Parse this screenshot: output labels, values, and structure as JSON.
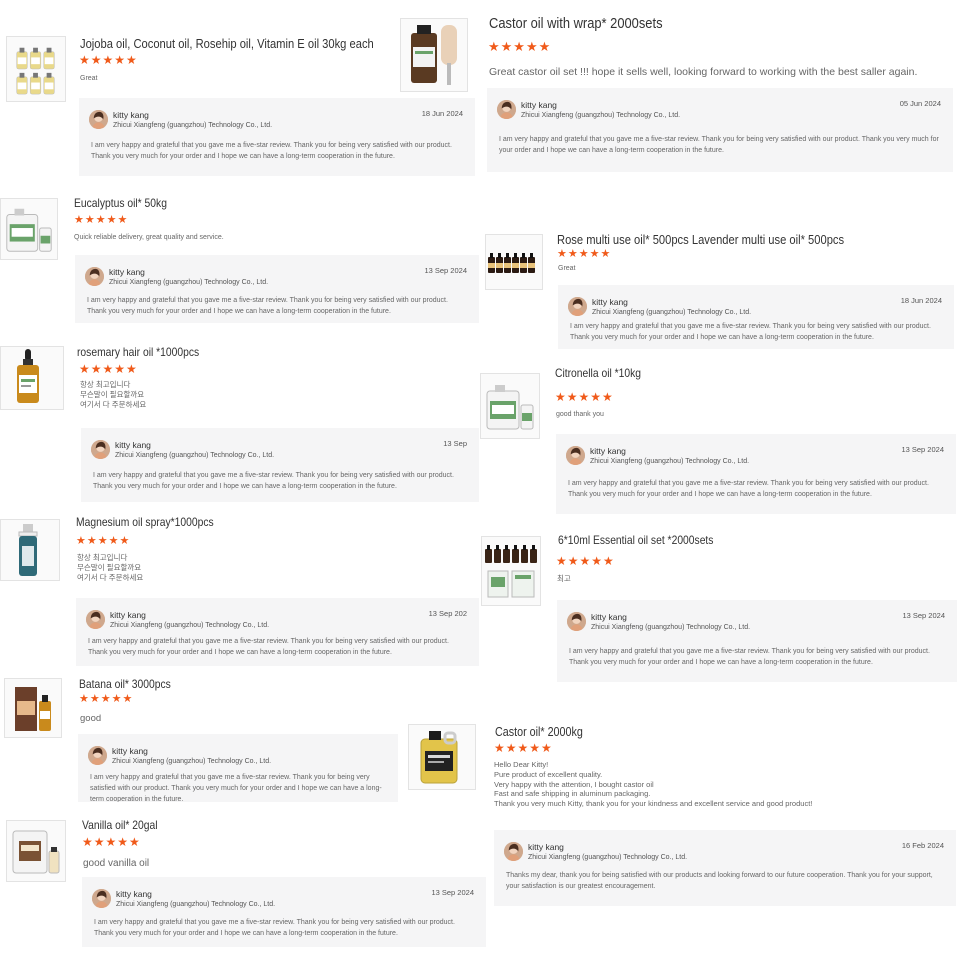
{
  "colors": {
    "star": "#f05a1a",
    "reply_bg": "#f5f5f6"
  },
  "reviews": [
    {
      "product": "Jojoba oil, Coconut oil, Rosehip oil, Vitamin E oil 30kg each",
      "stars": "★★★★★",
      "comment": "Great",
      "thumb_icon": "oil-bottles-set-icon",
      "reply": {
        "seller": "kitty kang",
        "company": "Zhicui Xiangfeng (guangzhou) Technology Co., Ltd.",
        "date": "18 Jun 2024",
        "text": "I am very happy and grateful that you gave me a five-star review. Thank you for being very satisfied with our product. Thank you very much for your order and I hope we can have a long-term cooperation in the future."
      }
    },
    {
      "product": "Castor oil with wrap* 2000sets",
      "stars": "★★★★★",
      "comment": "Great castor oil set !!! hope it sells well, looking forward to working with the best saller again.",
      "thumb_icon": "castor-oil-bottle-icon",
      "reply": {
        "seller": "kitty kang",
        "company": "Zhicui Xiangfeng (guangzhou) Technology Co., Ltd.",
        "date": "05 Jun 2024",
        "text": "I am very happy and grateful that you gave me a five-star review. Thank you for being very satisfied with our product. Thank you very much for your order and I hope we can have a long-term cooperation in the future."
      }
    },
    {
      "product": "Eucalyptus oil* 50kg",
      "stars": "★★★★★",
      "comment": "Quick reliable delivery, great quality and service.",
      "thumb_icon": "oil-drum-icon",
      "reply": {
        "seller": "kitty kang",
        "company": "Zhicui Xiangfeng (guangzhou) Technology Co., Ltd.",
        "date": "13 Sep 2024",
        "text": "I am very happy and grateful that you gave me a five-star review. Thank you for being very satisfied with our product. Thank you very much for your order and I hope we can have a long-term cooperation in the future."
      }
    },
    {
      "product": "Rose multi use oil* 500pcs Lavender multi use oil* 500pcs",
      "stars": "★★★★★",
      "comment": "Great",
      "thumb_icon": "bottle-row-icon",
      "reply": {
        "seller": "kitty kang",
        "company": "Zhicui Xiangfeng (guangzhou) Technology Co., Ltd.",
        "date": "18 Jun 2024",
        "text": "I am very happy and grateful that you gave me a five-star review. Thank you for being very satisfied with our product. Thank you very much for your order and I hope we can have a long-term cooperation in the future."
      }
    },
    {
      "product": "rosemary hair oil *1000pcs",
      "stars": "★★★★★",
      "comment": "항상 최고입니다\n무슨말이 필요할까요\n여기서 다 주문하세요",
      "thumb_icon": "dropper-bottle-icon",
      "reply": {
        "seller": "kitty kang",
        "company": "Zhicui Xiangfeng (guangzhou) Technology Co., Ltd.",
        "date": "13 Sep",
        "text": "I am very happy and grateful that you gave me a five-star review. Thank you for being very satisfied with our product. Thank you very much for your order and I hope we can have a long-term cooperation in the future."
      }
    },
    {
      "product": "Citronella oil *10kg",
      "stars": "★★★★★",
      "comment": "good thank you",
      "thumb_icon": "oil-drum-icon",
      "reply": {
        "seller": "kitty kang",
        "company": "Zhicui Xiangfeng (guangzhou) Technology Co., Ltd.",
        "date": "13 Sep 2024",
        "text": "I am very happy and grateful that you gave me a five-star review. Thank you for being very satisfied with our product. Thank you very much for your order and I hope we can have a long-term cooperation in the future."
      }
    },
    {
      "product": "Magnesium oil spray*1000pcs",
      "stars": "★★★★★",
      "comment": "항상 최고입니다\n무슨말이 필요할까요\n여기서 다 주문하세요",
      "thumb_icon": "spray-bottle-icon",
      "reply": {
        "seller": "kitty kang",
        "company": "Zhicui Xiangfeng (guangzhou) Technology Co., Ltd.",
        "date": "13 Sep 202",
        "text": "I am very happy and grateful that you gave me a five-star review. Thank you for being very satisfied with our product. Thank you very much for your order and I hope we can have a long-term cooperation in the future."
      }
    },
    {
      "product": "6*10ml Essential oil set *2000sets",
      "stars": "★★★★★",
      "comment": "최고",
      "thumb_icon": "essential-oil-set-icon",
      "reply": {
        "seller": "kitty kang",
        "company": "Zhicui Xiangfeng (guangzhou) Technology Co., Ltd.",
        "date": "13 Sep 2024",
        "text": "I am very happy and grateful that you gave me a five-star review. Thank you for being very satisfied with our product. Thank you very much for your order and I hope we can have a long-term cooperation in the future."
      }
    },
    {
      "product": "Batana oil* 3000pcs",
      "stars": "★★★★★",
      "comment": "good",
      "thumb_icon": "batana-oil-box-icon",
      "reply": {
        "seller": "kitty kang",
        "company": "Zhicui Xiangfeng (guangzhou) Technology Co., Ltd.",
        "date": "",
        "text": "I am very happy and grateful that you gave me a five-star review. Thank you for being very satisfied with our product. Thank you very much for your order and I hope we can have a long-term cooperation in the future."
      }
    },
    {
      "product": "Castor oil* 2000kg",
      "stars": "★★★★★",
      "comment": "Hello Dear Kitty!\nPure product of excellent quality.\nVery happy with the attention, I bought castor oil\nFast and safe shipping in aluminum packaging.\nThank you very much Kitty, thank you for your kindness and excellent service and good product!",
      "thumb_icon": "oil-jug-icon",
      "reply": {
        "seller": "kitty kang",
        "company": "Zhicui Xiangfeng (guangzhou) Technology Co., Ltd.",
        "date": "16 Feb 2024",
        "text": "Thanks my dear, thank you for being satisfied with our products and looking forward to our future cooperation. Thank you for your support, your satisfaction is our greatest encouragement."
      }
    },
    {
      "product": "Vanilla oil* 20gal",
      "stars": "★★★★★",
      "comment": "good vanilla oil",
      "thumb_icon": "vanilla-oil-drum-icon",
      "reply": {
        "seller": "kitty kang",
        "company": "Zhicui Xiangfeng (guangzhou) Technology Co., Ltd.",
        "date": "13 Sep 2024",
        "text": "I am very happy and grateful that you gave me a five-star review. Thank you for being very satisfied with our product. Thank you very much for your order and I hope we can have a long-term cooperation in the future."
      }
    }
  ]
}
